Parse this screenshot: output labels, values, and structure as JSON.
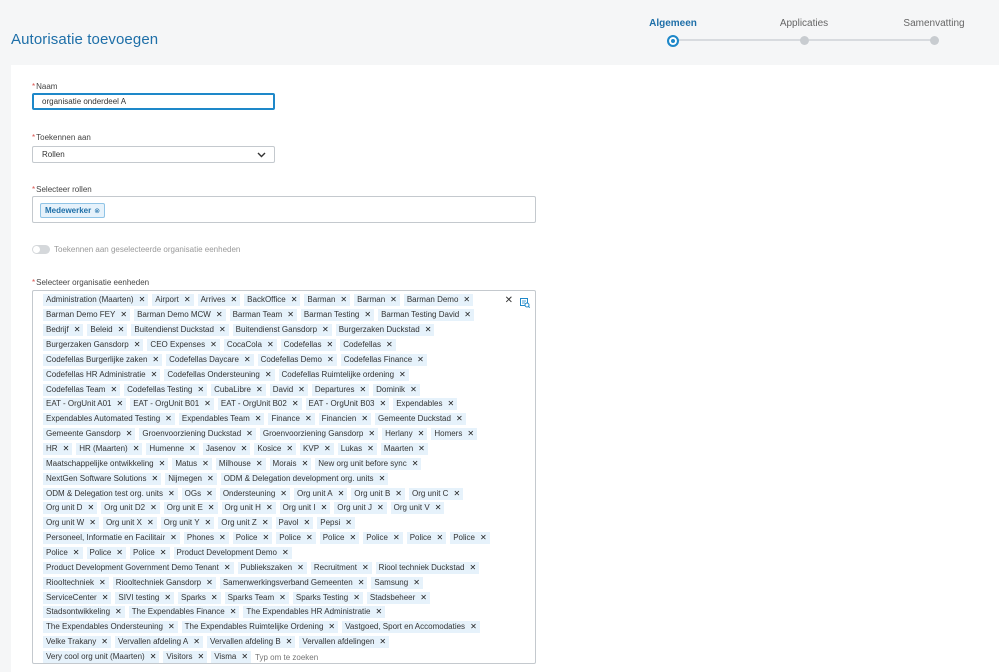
{
  "header": {
    "title": "Autorisatie toevoegen"
  },
  "stepper": {
    "steps": [
      {
        "label": "Algemeen",
        "active": true
      },
      {
        "label": "Applicaties",
        "active": false
      },
      {
        "label": "Samenvatting",
        "active": false
      }
    ]
  },
  "form": {
    "name": {
      "label": "Naam",
      "value": "organisatie onderdeel A"
    },
    "assign_to": {
      "label": "Toekennen aan",
      "value": "Rollen"
    },
    "roles": {
      "label": "Selecteer rollen",
      "selected": "Medewerker",
      "remove_symbol": "⊗"
    },
    "toggle": {
      "label": "Toekennen aan geselecteerde organisatie eenheden",
      "on": false
    },
    "org_units": {
      "label": "Selecteer organisatie eenheden",
      "placeholder": "Typ om te zoeken",
      "remove_symbol": "✕",
      "clear_symbol": "✕",
      "rows": [
        [
          "Administration (Maarten)",
          "Airport",
          "Arrives",
          "BackOffice",
          "Barman",
          "Barman",
          "Barman Demo"
        ],
        [
          "Barman Demo FEY",
          "Barman Demo MCW",
          "Barman Team",
          "Barman Testing",
          "Barman Testing David"
        ],
        [
          "Bedrijf",
          "Beleid",
          "Buitendienst Duckstad",
          "Buitendienst Gansdorp",
          "Burgerzaken Duckstad"
        ],
        [
          "Burgerzaken Gansdorp",
          "CEO Expenses",
          "CocaCola",
          "Codefellas",
          "Codefellas"
        ],
        [
          "Codefellas Burgerlijke zaken",
          "Codefellas Daycare",
          "Codefellas Demo",
          "Codefellas Finance"
        ],
        [
          "Codefellas HR Administratie",
          "Codefellas Ondersteuning",
          "Codefellas Ruimtelijke ordening"
        ],
        [
          "Codefellas Team",
          "Codefellas Testing",
          "CubaLibre",
          "David",
          "Departures",
          "Dominik"
        ],
        [
          "EAT - OrgUnit A01",
          "EAT - OrgUnit B01",
          "EAT - OrgUnit B02",
          "EAT - OrgUnit B03",
          "Expendables"
        ],
        [
          "Expendables Automated Testing",
          "Expendables Team",
          "Finance",
          "Financien",
          "Gemeente Duckstad"
        ],
        [
          "Gemeente Gansdorp",
          "Groenvoorziening Duckstad",
          "Groenvoorziening Gansdorp",
          "Herlany",
          "Homers"
        ],
        [
          "HR",
          "HR (Maarten)",
          "Humenne",
          "Jasenov",
          "Kosice",
          "KVP",
          "Lukas",
          "Maarten"
        ],
        [
          "Maatschappelijke ontwikkeling",
          "Matus",
          "Milhouse",
          "Morais",
          "New org unit before sync"
        ],
        [
          "NextGen Software Solutions",
          "Nijmegen",
          "ODM & Delegation development org. units"
        ],
        [
          "ODM & Delegation test org. units",
          "OGs",
          "Ondersteuning",
          "Org unit A",
          "Org unit B",
          "Org unit C"
        ],
        [
          "Org unit D",
          "Org unit D2",
          "Org unit E",
          "Org unit H",
          "Org unit I",
          "Org unit J",
          "Org unit V"
        ],
        [
          "Org unit W",
          "Org unit X",
          "Org unit Y",
          "Org unit Z",
          "Pavol",
          "Pepsi"
        ],
        [
          "Personeel, Informatie en Facilitair",
          "Phones",
          "Police",
          "Police",
          "Police",
          "Police",
          "Police",
          "Police"
        ],
        [
          "Police",
          "Police",
          "Police",
          "Product Development Demo"
        ],
        [
          "Product Development Government Demo Tenant",
          "Publiekszaken",
          "Recruitment",
          "Riool techniek Duckstad"
        ],
        [
          "Riooltechniek",
          "Riooltechniek Gansdorp",
          "Samenwerkingsverband Gemeenten",
          "Samsung"
        ],
        [
          "ServiceCenter",
          "SIVI testing",
          "Sparks",
          "Sparks Team",
          "Sparks Testing",
          "Stadsbeheer"
        ],
        [
          "Stadsontwikkeling",
          "The Expendables Finance",
          "The Expendables HR Administratie"
        ],
        [
          "The Expendables Ondersteuning",
          "The Expendables Ruimtelijke Ordening",
          "Vastgoed, Sport en Accomodaties"
        ],
        [
          "Velke Trakany",
          "Vervallen afdeling A",
          "Vervallen afdeling B",
          "Vervallen afdelingen"
        ],
        [
          "Very cool org unit (Maarten)",
          "Visitors",
          "Visma"
        ]
      ]
    }
  },
  "colors": {
    "accent": "#1e88c9",
    "title": "#1e6fa8",
    "tag_bg": "#e6f2fb"
  }
}
